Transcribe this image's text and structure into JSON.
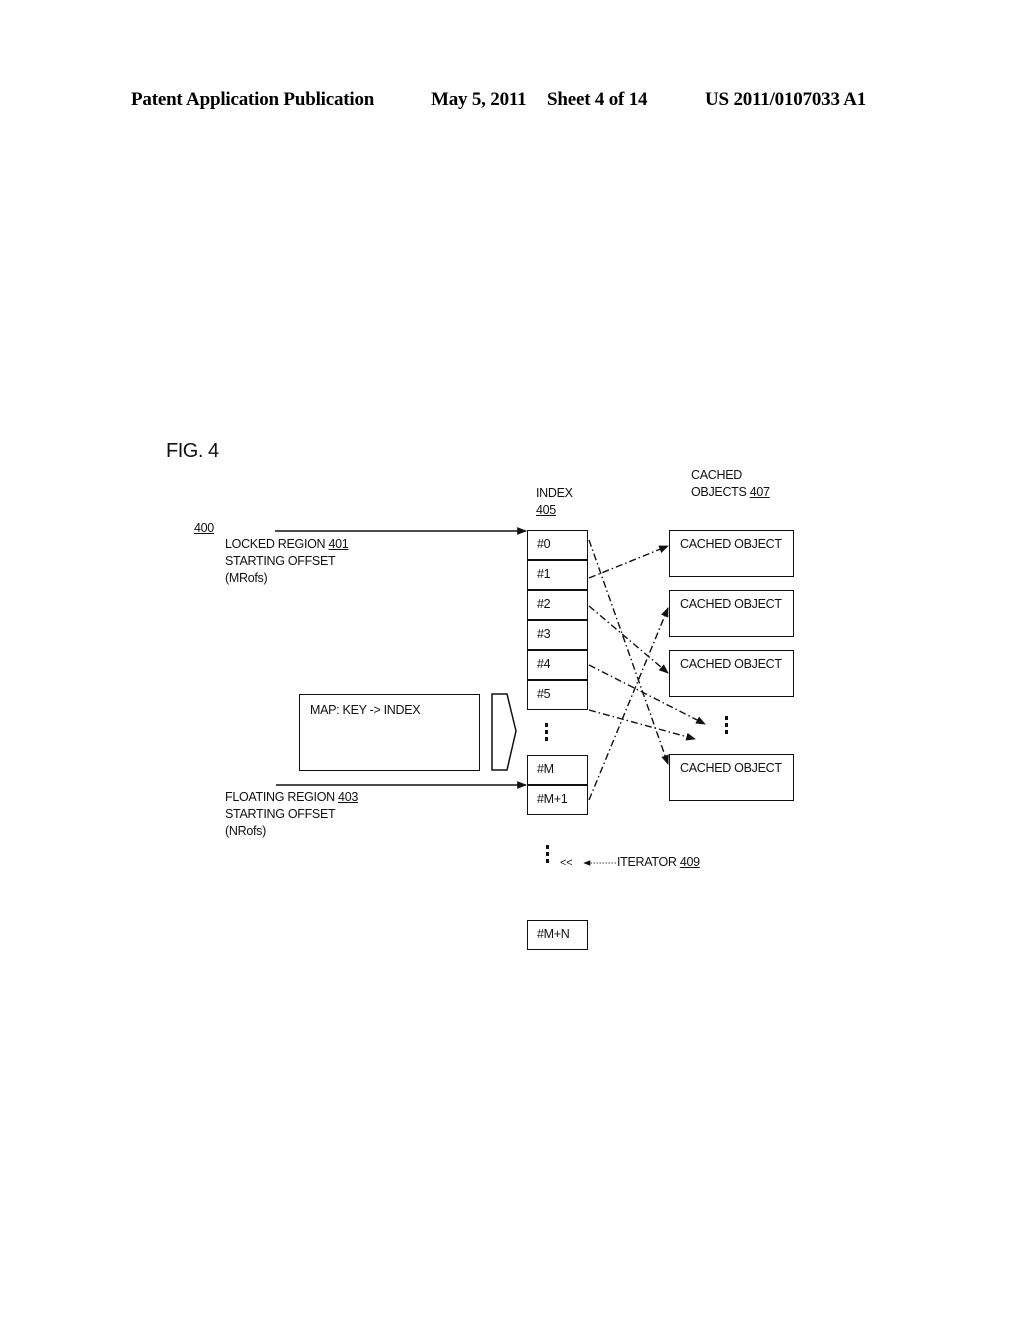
{
  "header": {
    "publication": "Patent Application Publication",
    "date": "May 5, 2011",
    "sheet": "Sheet 4 of 14",
    "number": "US 2011/0107033 A1"
  },
  "figure": {
    "title": "FIG. 4",
    "ref_number": "400",
    "locked_region": {
      "line1_text": "LOCKED REGION ",
      "line1_ref": "401",
      "line2": "STARTING OFFSET",
      "line3": "(MRofs)"
    },
    "floating_region": {
      "line1_text": "FLOATING REGION ",
      "line1_ref": "403",
      "line2": "STARTING OFFSET",
      "line3": "(NRofs)"
    },
    "index": {
      "title": "INDEX",
      "ref": "405",
      "cells_top": [
        "#0",
        "#1",
        "#2",
        "#3",
        "#4",
        "#5"
      ],
      "cells_mid": [
        "#M",
        "#M+1"
      ],
      "cell_last": "#M+N"
    },
    "cached_objects": {
      "title_line1": "CACHED",
      "title_line2_text": "OBJECTS ",
      "title_ref": "407",
      "items": [
        "CACHED OBJECT",
        "CACHED OBJECT",
        "CACHED OBJECT",
        "CACHED OBJECT"
      ]
    },
    "map": {
      "label": "MAP: KEY -> INDEX"
    },
    "iterator": {
      "marker": "<<",
      "label_text": "ITERATOR ",
      "label_ref": "409"
    },
    "mappings": [
      {
        "from": "#0",
        "to": "cached-object-4"
      },
      {
        "from": "#1",
        "to": "cached-object-1"
      },
      {
        "from": "#2",
        "to": "cached-object-3"
      },
      {
        "from": "#4",
        "to": "ellipsis"
      },
      {
        "from": "#5",
        "to": "ellipsis"
      },
      {
        "from": "#M+1",
        "to": "cached-object-2"
      }
    ]
  }
}
